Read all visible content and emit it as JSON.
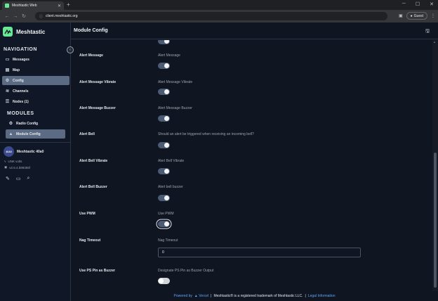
{
  "browser": {
    "tab_title": "Meshtastic Web",
    "url": "client.meshtastic.org",
    "profile_label": "Guest",
    "icons": [
      "back-icon",
      "forward-icon",
      "reload-icon",
      "info-icon",
      "minimize-icon",
      "maximize-icon",
      "close-icon",
      "menu-icon"
    ]
  },
  "app": {
    "brand": "Meshtastic",
    "navigation_heading": "NAVIGATION",
    "nav_items": [
      {
        "label": "Messages",
        "icon": "message-icon"
      },
      {
        "label": "Map",
        "icon": "map-icon"
      },
      {
        "label": "Config",
        "icon": "gear-icon"
      },
      {
        "label": "Channels",
        "icon": "channels-icon"
      },
      {
        "label": "Nodes (1)",
        "icon": "users-icon"
      }
    ],
    "modules_heading": "MODULES",
    "module_items": [
      {
        "label": "Radio Config",
        "icon": "gear-icon"
      },
      {
        "label": "Module Config",
        "icon": "module-icon"
      }
    ],
    "node": {
      "avatar": "40A0",
      "name": "Meshtastic 40a0",
      "voltage": "UNK volts",
      "firmware": "v2.6.4.b89355f"
    },
    "colors": {
      "accent": "#67ea94",
      "active_item": "#5b6b84",
      "background": "#0f1521",
      "link": "#60a5fa"
    }
  },
  "main": {
    "title": "Module Config",
    "rows": [
      {
        "label": "Alert Message",
        "description": "Alert Message",
        "type": "toggle",
        "on": true
      },
      {
        "label": "Alert Message Vibrate",
        "description": "Alert Message Vibrate",
        "type": "toggle",
        "on": true
      },
      {
        "label": "Alert Message Buzzer",
        "description": "Alert Message Buzzer",
        "type": "toggle",
        "on": true
      },
      {
        "label": "Alert Bell",
        "description": "Should an alert be triggered when receiving an incoming bell?",
        "type": "toggle",
        "on": true
      },
      {
        "label": "Alert Bell Vibrate",
        "description": "Alert Bell Vibrate",
        "type": "toggle",
        "on": true
      },
      {
        "label": "Alert Bell Buzzer",
        "description": "Alert bell buzzer",
        "type": "toggle",
        "on": true
      },
      {
        "label": "Use PWM",
        "description": "Use PWM",
        "type": "toggle",
        "on": true
      },
      {
        "label": "Nag Timeout",
        "description": "Nag Timeout",
        "type": "number",
        "value": "0"
      },
      {
        "label": "Use PS Pin as Buzzer",
        "description": "Designate PS Pin as Buzzer Output",
        "type": "toggle",
        "on": false
      }
    ]
  },
  "footer": {
    "powered": "Powered by",
    "vercel": "▲ Vercel",
    "separator": "|",
    "trademark": "Meshtastic® is a registered trademark of Meshtastic LLC.",
    "separator2": "|",
    "legal": "Legal Information"
  }
}
